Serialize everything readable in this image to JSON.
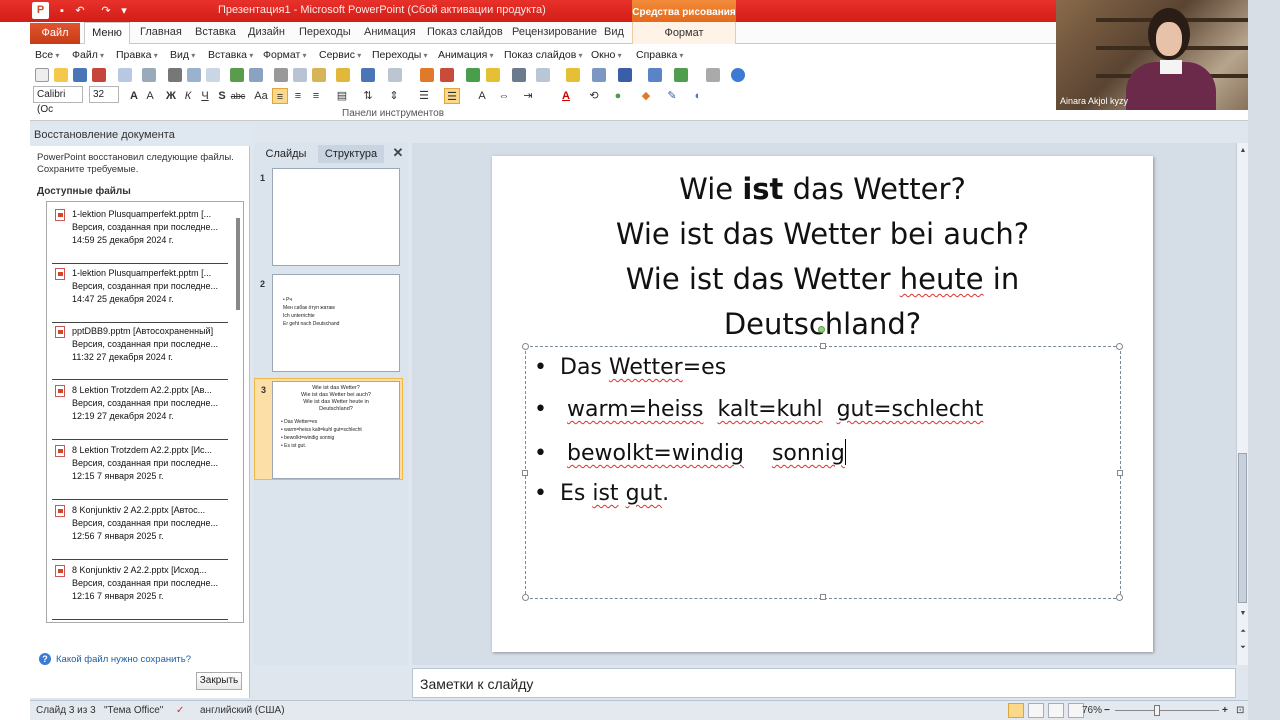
{
  "window": {
    "title": "Презентация1 - Microsoft PowerPoint (Сбой активации продукта)",
    "app_icon": "P",
    "contextual_header": "Средства рисования"
  },
  "ribbon": {
    "tabs": [
      "Файл",
      "Меню",
      "Главная",
      "Вставка",
      "Дизайн",
      "Переходы",
      "Анимация",
      "Показ слайдов",
      "Рецензирование",
      "Вид",
      "Формат"
    ],
    "menus": [
      "Все",
      "Файл",
      "Правка",
      "Вид",
      "Вставка",
      "Формат",
      "Сервис",
      "Переходы",
      "Анимация",
      "Показ слайдов",
      "Окно",
      "Справка"
    ],
    "font_name": "Calibri (Ос",
    "font_size": "32",
    "format_buttons": [
      "Ж",
      "К",
      "Ч",
      "S",
      "abc",
      "Аа"
    ],
    "toolbars_label": "Панели инструментов"
  },
  "webcam": {
    "name": "Ainara Akjol kyzy"
  },
  "recovery": {
    "header": "Восстановление документа",
    "message": "PowerPoint восстановил следующие файлы. Сохраните требуемые.",
    "available_label": "Доступные файлы",
    "files": [
      {
        "name": "1-lektion Plusquamperfekt.pptm  [...",
        "desc": "Версия, созданная при последне...",
        "time": "14:59 25 декабря 2024 г."
      },
      {
        "name": "1-lektion Plusquamperfekt.pptm  [...",
        "desc": "Версия, созданная при последне...",
        "time": "14:47 25 декабря 2024 г."
      },
      {
        "name": "pptDBB9.pptm  [Автосохраненный]",
        "desc": "Версия, созданная при последне...",
        "time": "11:32 27 декабря 2024 г."
      },
      {
        "name": "8 Lektion Trotzdem A2.2.pptx  [Ав...",
        "desc": "Версия, созданная при последне...",
        "time": "12:19 27 декабря 2024 г."
      },
      {
        "name": "8 Lektion Trotzdem A2.2.pptx  [Ис...",
        "desc": "Версия, созданная при последне...",
        "time": "12:15 7 января 2025 г."
      },
      {
        "name": "8   Konjunktiv 2 A2.2.pptx  [Автос...",
        "desc": "Версия, созданная при последне...",
        "time": "12:56 7 января 2025 г."
      },
      {
        "name": "8   Konjunktiv 2 A2.2.pptx  [Исход...",
        "desc": "Версия, созданная при последне...",
        "time": "12:16 7 января 2025 г."
      }
    ],
    "help_link": "Какой файл нужно сохранить?",
    "close_button": "Закрыть"
  },
  "slides_pane": {
    "tab_slides": "Слайды",
    "tab_outline": "Структура",
    "close": "✕",
    "thumbs": [
      {
        "num": "1"
      },
      {
        "num": "2",
        "lines": [
          "• Рч",
          "Мен сабак óтуп жатам",
          "Ich unterrichte",
          "Er geht nach Deutschand"
        ]
      },
      {
        "num": "3",
        "title_lines": [
          "Wie ist das Wetter?",
          "Wie ist das Wetter bei auch?",
          "Wie ist das Wetter heute in",
          "Deutschland?"
        ],
        "lines": [
          "• Das Wetter=es",
          "•  warm=heiss  kalt=kuhl  gut=schlecht",
          "•  bewolkt=windig   sonnig",
          "• Es ist gut."
        ]
      }
    ]
  },
  "slide": {
    "title": {
      "line1_pre": "Wie ",
      "line1_bold": "ist",
      "line1_post": " das Wetter?",
      "line2": "Wie ist das Wetter bei auch?",
      "line3_pre": "Wie ist das Wetter ",
      "line3_heute": "heute",
      "line3_post": " in",
      "line4": "Deutschland?"
    },
    "bullets": [
      {
        "dot": "•",
        "parts": [
          "Das ",
          "Wetter",
          "=es"
        ]
      },
      {
        "dot": "•",
        "parts": [
          " ",
          "warm=heiss",
          "  ",
          "kalt=kuhl",
          "  ",
          "gut=schlecht",
          ""
        ]
      },
      {
        "dot": "•",
        "parts": [
          " ",
          "bewolkt=windig",
          "    ",
          "sonnig",
          ""
        ]
      },
      {
        "dot": "•",
        "parts": [
          "Es ",
          "ist",
          " ",
          "gut",
          "."
        ]
      }
    ]
  },
  "notes": {
    "placeholder": "Заметки к слайду"
  },
  "statusbar": {
    "slide_info": "Слайд 3 из 3",
    "theme": "\"Тема Office\"",
    "language": "английский (США)",
    "zoom": "76%",
    "zoom_minus": "−",
    "zoom_plus": "+"
  },
  "colors": {
    "accent": "#d24726",
    "titlebar": "#d9261e",
    "contextual": "#e87826",
    "spell_error": "#e03030"
  }
}
